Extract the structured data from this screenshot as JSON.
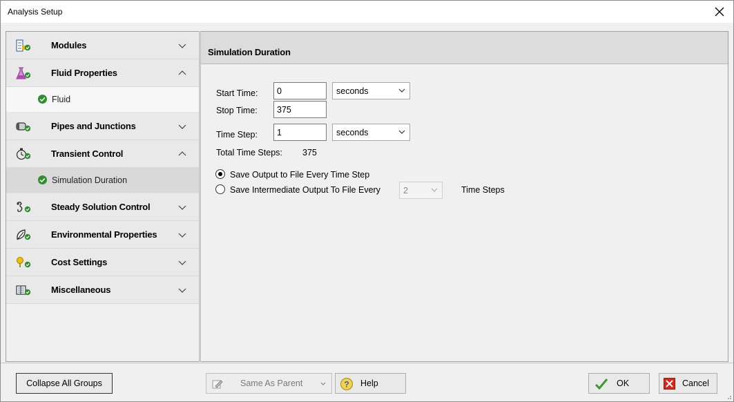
{
  "window": {
    "title": "Analysis Setup"
  },
  "sidebar": {
    "items": [
      {
        "type": "group",
        "label": "Modules",
        "icon": "modules-icon",
        "expanded": false
      },
      {
        "type": "group",
        "label": "Fluid Properties",
        "icon": "flask-icon",
        "expanded": true
      },
      {
        "type": "sub",
        "label": "Fluid",
        "status": "complete",
        "selected": false
      },
      {
        "type": "group",
        "label": "Pipes and Junctions",
        "icon": "pipe-icon",
        "expanded": false
      },
      {
        "type": "group",
        "label": "Transient Control",
        "icon": "stopwatch-icon",
        "expanded": true
      },
      {
        "type": "sub",
        "label": "Simulation Duration",
        "status": "complete",
        "selected": true
      },
      {
        "type": "group",
        "label": "Steady Solution Control",
        "icon": "solution-icon",
        "expanded": false
      },
      {
        "type": "group",
        "label": "Environmental Properties",
        "icon": "leaf-icon",
        "expanded": false
      },
      {
        "type": "group",
        "label": "Cost Settings",
        "icon": "cost-icon",
        "expanded": false
      },
      {
        "type": "group",
        "label": "Miscellaneous",
        "icon": "misc-icon",
        "expanded": false
      }
    ]
  },
  "panel": {
    "title": "Simulation Duration",
    "start_time": {
      "label": "Start Time:",
      "value": "0",
      "unit": "seconds"
    },
    "stop_time": {
      "label": "Stop Time:",
      "value": "375"
    },
    "time_step": {
      "label": "Time Step:",
      "value": "1",
      "unit": "seconds"
    },
    "total_steps": {
      "label": "Total Time Steps:",
      "value": "375"
    },
    "output": {
      "option1": {
        "label": "Save Output to File Every Time Step",
        "checked": true
      },
      "option2": {
        "label": "Save Intermediate Output To File Every",
        "checked": false,
        "interval": "2",
        "suffix": "Time Steps"
      }
    }
  },
  "footer": {
    "collapse_label": "Collapse All Groups",
    "same_as_parent_label": "Same As Parent",
    "help_label": "Help",
    "ok_label": "OK",
    "cancel_label": "Cancel"
  },
  "colors": {
    "check_green": "#2f8f2f",
    "cancel_red": "#d9261c",
    "ok_green": "#3a9a2a"
  }
}
